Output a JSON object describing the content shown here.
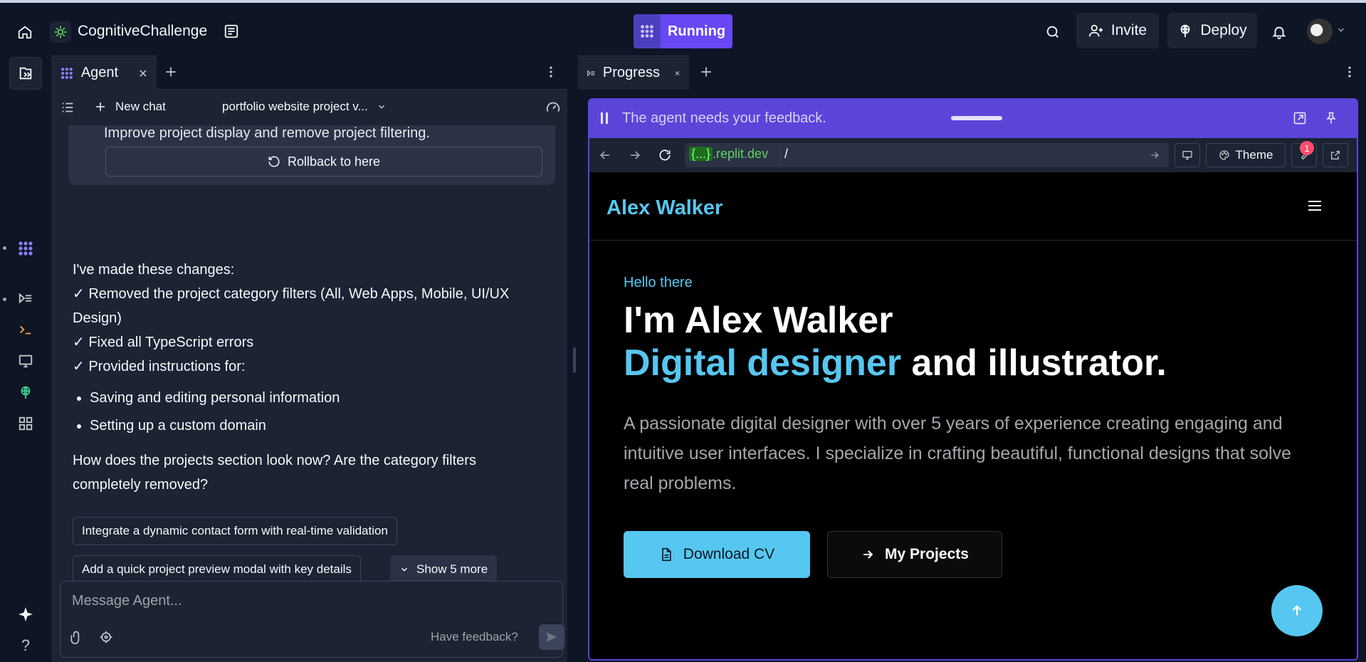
{
  "topbar": {
    "repl_name": "CognitiveChallenge",
    "run_label": "Running",
    "invite_label": "Invite",
    "deploy_label": "Deploy"
  },
  "agent": {
    "tab_label": "Agent",
    "new_chat_label": "New chat",
    "chat_title": "portfolio website project v...",
    "prev_checkpoint_text": "Improve project display and remove project filtering.",
    "rollback_label": "Rollback to here",
    "message_intro": "I've made these changes:",
    "message_checks": [
      "✓ Removed the project category filters (All, Web Apps, Mobile, UI/UX Design)",
      "✓ Fixed all TypeScript errors",
      "✓ Provided instructions for:"
    ],
    "message_bullets": [
      "Saving and editing personal information",
      "Setting up a custom domain"
    ],
    "message_question": "How does the projects section look now? Are the category filters completely removed?",
    "suggestions": [
      "Integrate a dynamic contact form with real-time validation",
      "Add a quick project preview modal with key details"
    ],
    "show_more_label": "Show 5 more",
    "input_placeholder": "Message Agent...",
    "feedback_label": "Have feedback?"
  },
  "progress": {
    "tab_label": "Progress",
    "feedback_banner": "The agent needs your feedback.",
    "url_host_brace": "{...}",
    "url_host_rest": ".replit.dev",
    "url_path": "/",
    "theme_label": "Theme",
    "badge_count": "1"
  },
  "site": {
    "logo": "Alex Walker",
    "greeting": "Hello there",
    "headline_line1": "I'm Alex Walker",
    "headline_accent": "Digital designer",
    "headline_rest": " and illustrator.",
    "lead": "A passionate digital designer with over 5 years of experience creating engaging and intuitive user interfaces. I specialize in crafting beautiful, functional designs that solve real problems.",
    "cv_button": "Download CV",
    "projects_button": "My Projects"
  },
  "colors": {
    "accent": "#56c7f0",
    "running": "#6847f5",
    "feedback_bar": "#5b45d9",
    "panel_bg": "#1c2333",
    "app_bg": "#0e1525"
  }
}
